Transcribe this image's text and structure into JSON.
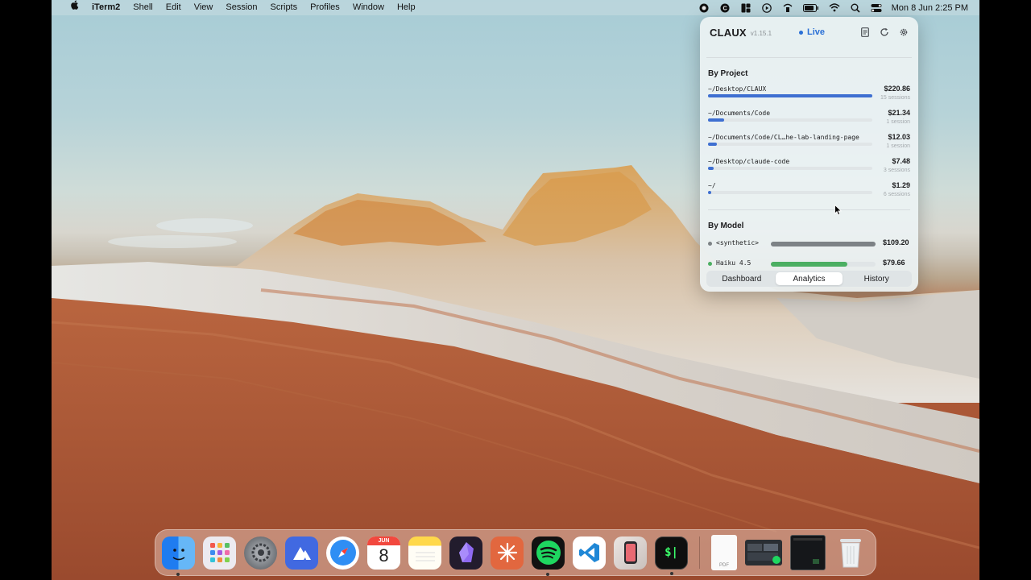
{
  "menubar": {
    "apple": "",
    "app_name": "iTerm2",
    "menus": [
      "Shell",
      "Edit",
      "View",
      "Session",
      "Scripts",
      "Profiles",
      "Window",
      "Help"
    ],
    "clock": "Mon 8 Jun  2:25 PM",
    "status_icons": [
      "record-icon",
      "claux-icon",
      "window-layout-icon",
      "play-icon",
      "wifi-calling-icon",
      "battery-icon",
      "wifi-icon",
      "search-icon",
      "control-center-icon"
    ]
  },
  "panel": {
    "brand": "CLAUX",
    "version": "v1.15.1",
    "live_label": "Live",
    "by_project_title": "By Project",
    "projects": [
      {
        "path": "~/Desktop/CLAUX",
        "cost": "$220.86",
        "sessions": "15 sessions",
        "share": 1.0
      },
      {
        "path": "~/Documents/Code",
        "cost": "$21.34",
        "sessions": "1 session",
        "share": 0.097
      },
      {
        "path": "~/Documents/Code/CL…he-lab-landing-page",
        "cost": "$12.03",
        "sessions": "1 session",
        "share": 0.055
      },
      {
        "path": "~/Desktop/claude-code",
        "cost": "$7.48",
        "sessions": "3 sessions",
        "share": 0.034
      },
      {
        "path": "~/",
        "cost": "$1.29",
        "sessions": "6 sessions",
        "share": 0.006
      }
    ],
    "by_model_title": "By Model",
    "models": [
      {
        "name": "<synthetic>",
        "cost": "$109.20",
        "share": 1.0,
        "color": "#7d8286"
      },
      {
        "name": "Haiku 4.5",
        "cost": "$79.66",
        "share": 0.73,
        "color": "#4caf62"
      }
    ],
    "tabs": [
      {
        "label": "Dashboard",
        "active": false
      },
      {
        "label": "Analytics",
        "active": true
      },
      {
        "label": "History",
        "active": false
      }
    ]
  },
  "dock": {
    "apps": [
      {
        "name": "finder",
        "glyph": "☺",
        "bg": "#3d8ef0",
        "running": true
      },
      {
        "name": "launchpad",
        "glyph": "▦",
        "bg": "#e9e9ee",
        "running": false
      },
      {
        "name": "system-settings",
        "glyph": "⚙",
        "bg": "#8e8e93",
        "running": false
      },
      {
        "name": "nordvpn",
        "glyph": "⛰",
        "bg": "#3f66e0",
        "running": false
      },
      {
        "name": "safari",
        "glyph": "✧",
        "bg": "#2f8ef4",
        "running": false
      },
      {
        "name": "calendar",
        "glyph": "8",
        "bg": "#ffffff",
        "running": false
      },
      {
        "name": "notes",
        "glyph": "≡",
        "bg": "#ffd84a",
        "running": false
      },
      {
        "name": "obsidian",
        "glyph": "◆",
        "bg": "#2b2436",
        "running": false
      },
      {
        "name": "claude",
        "glyph": "✳",
        "bg": "#e0643f",
        "running": false
      },
      {
        "name": "spotify",
        "glyph": "◉",
        "bg": "#1ed760",
        "running": true
      },
      {
        "name": "vscode",
        "glyph": "◁",
        "bg": "#ffffff",
        "running": false
      },
      {
        "name": "iphone-mirroring",
        "glyph": "▯",
        "bg": "#d9d2cf",
        "running": false
      },
      {
        "name": "iterm2",
        "glyph": "$|",
        "bg": "#141414",
        "running": true
      }
    ],
    "calendar_month": "JUN",
    "calendar_day": "8",
    "pdf_label": "PDF"
  }
}
